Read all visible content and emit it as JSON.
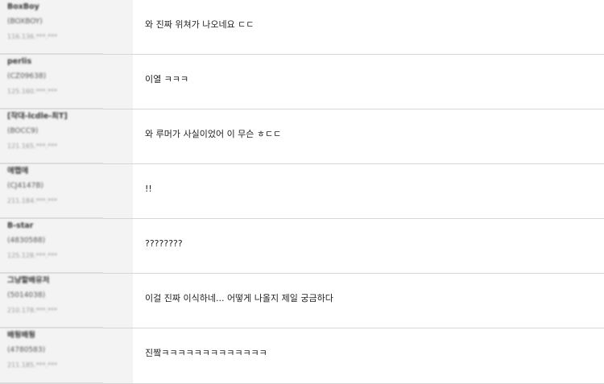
{
  "comments": [
    {
      "nick": "BoxBoy",
      "uid": "(BOXBOY)",
      "ip": "116.136.***.***",
      "text": "와 진짜 위쳐가 나오네요 ㄷㄷ"
    },
    {
      "nick": "perlis",
      "uid": "(CZ09638)",
      "ip": "125.160.***.***",
      "text": "이열 ㅋㅋㅋ"
    },
    {
      "nick": "[작대-lcdle-최T]",
      "uid": "(BOCC9)",
      "ip": "121.165.***.***",
      "text": "와 루머가 사실이었어 이 무슨 ㅎㄷㄷ"
    },
    {
      "nick": "에뗍에",
      "uid": "(CJ4147B)",
      "ip": "211.184.***.***",
      "text": "!!"
    },
    {
      "nick": "B-star",
      "uid": "(4830588)",
      "ip": "125.128.***.***",
      "text": "????????"
    },
    {
      "nick": "그냥할배유저",
      "uid": "(5014038)",
      "ip": "210.178.***.***",
      "text": "이걸 진짜 이식하네... 어떻게 나올지 제일 궁금하다"
    },
    {
      "nick": "배뒹배뒹",
      "uid": "(4780583)",
      "ip": "211.185.***.***",
      "text": "진짴ㅋㅋㅋㅋㅋㅋㅋㅋㅋㅋㅋㅋㅋ"
    }
  ]
}
